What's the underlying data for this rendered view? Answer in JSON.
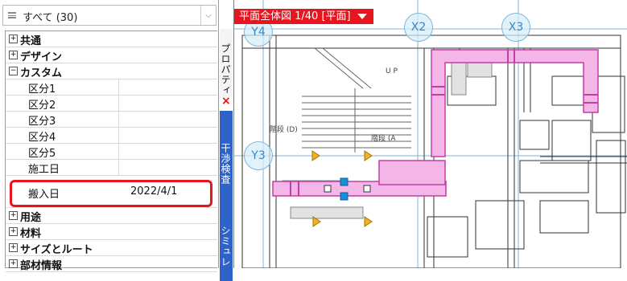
{
  "filter": {
    "label": "すべて (30)",
    "icon": "list-group-icon",
    "dropdown_icon": "chevron-down-icon"
  },
  "tree": [
    {
      "type": "category",
      "toggle": "⊞",
      "label": "共通"
    },
    {
      "type": "category",
      "toggle": "⊞",
      "label": "デザイン"
    },
    {
      "type": "category",
      "toggle": "⊟",
      "label": "カスタム"
    },
    {
      "type": "property",
      "label": "区分1",
      "value": ""
    },
    {
      "type": "property",
      "label": "区分2",
      "value": ""
    },
    {
      "type": "property",
      "label": "区分3",
      "value": ""
    },
    {
      "type": "property",
      "label": "区分4",
      "value": ""
    },
    {
      "type": "property",
      "label": "区分5",
      "value": ""
    },
    {
      "type": "property",
      "label": "施工日",
      "value": ""
    },
    {
      "type": "property",
      "label": "搬入日",
      "value": "2022/4/1"
    },
    {
      "type": "category",
      "toggle": "⊞",
      "label": "用途"
    },
    {
      "type": "category",
      "toggle": "⊞",
      "label": "材料"
    },
    {
      "type": "category",
      "toggle": "⊞",
      "label": "サイズとルート"
    },
    {
      "type": "category",
      "toggle": "⊞",
      "label": "部材情報"
    }
  ],
  "side_tabs": {
    "properties": "プロパティ",
    "close": "×",
    "check": "干渉検査",
    "simulation": "シミュレ"
  },
  "view": {
    "title": "平面全体図 1/40 [平面]",
    "menu_icon": "triangle-down-icon"
  },
  "grid": [
    "Y4",
    "X2",
    "X3",
    "Y3"
  ],
  "room_labels": [
    "U P",
    "階段 (D)",
    "階段 (A"
  ],
  "colors": {
    "highlight": "#e8141e",
    "tab_active": "#2d63c8",
    "duct": "#e75ac7",
    "selection": "#1a8fd6"
  }
}
